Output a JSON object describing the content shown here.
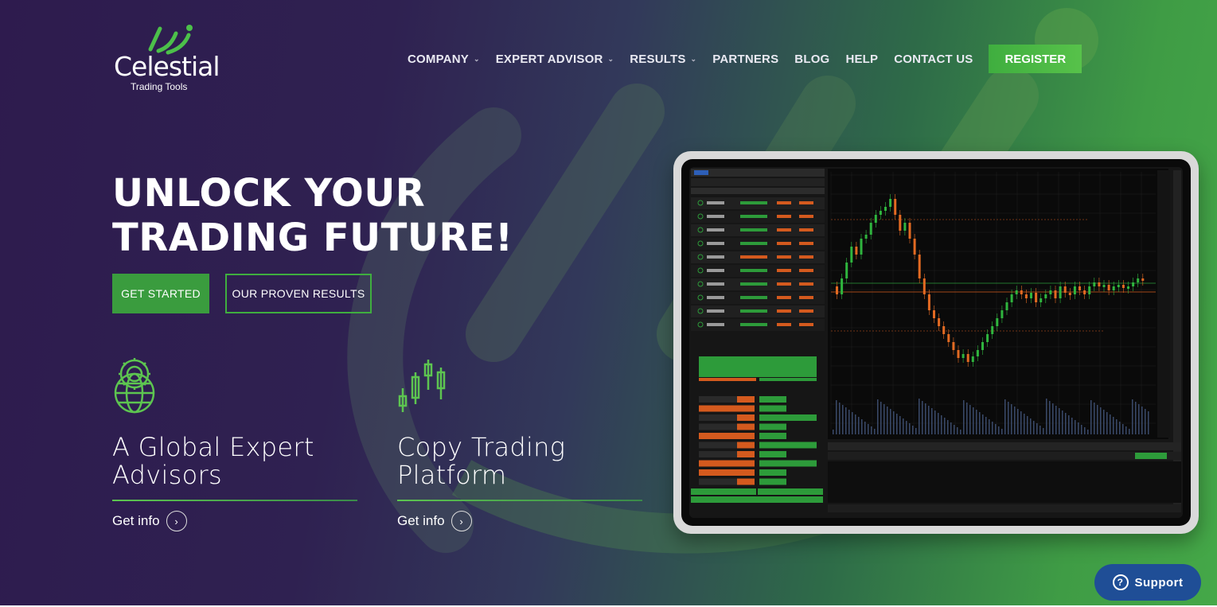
{
  "brand": {
    "name": "Celestial",
    "tagline": "Trading Tools"
  },
  "nav": {
    "items": [
      {
        "label": "COMPANY",
        "has_dropdown": true
      },
      {
        "label": "EXPERT ADVISOR",
        "has_dropdown": true
      },
      {
        "label": "RESULTS",
        "has_dropdown": true
      },
      {
        "label": "PARTNERS",
        "has_dropdown": false
      },
      {
        "label": "BLOG",
        "has_dropdown": false
      },
      {
        "label": "HELP",
        "has_dropdown": false
      },
      {
        "label": "CONTACT US",
        "has_dropdown": false
      }
    ],
    "register": "REGISTER"
  },
  "hero": {
    "line1": "UNLOCK YOUR",
    "line2": "TRADING FUTURE!",
    "cta_primary": "GET STARTED",
    "cta_secondary": "OUR PROVEN RESULTS"
  },
  "features": [
    {
      "title_line1": "A Global Expert",
      "title_line2": "Advisors",
      "link": "Get info",
      "icon": "globe-gear-icon"
    },
    {
      "title_line1": "Copy Trading",
      "title_line2": "Platform",
      "link": "Get info",
      "icon": "candlestick-icon"
    }
  ],
  "support": {
    "label": "Support"
  },
  "colors": {
    "accent": "#3fae3f",
    "support_bg": "#1f4e96"
  }
}
